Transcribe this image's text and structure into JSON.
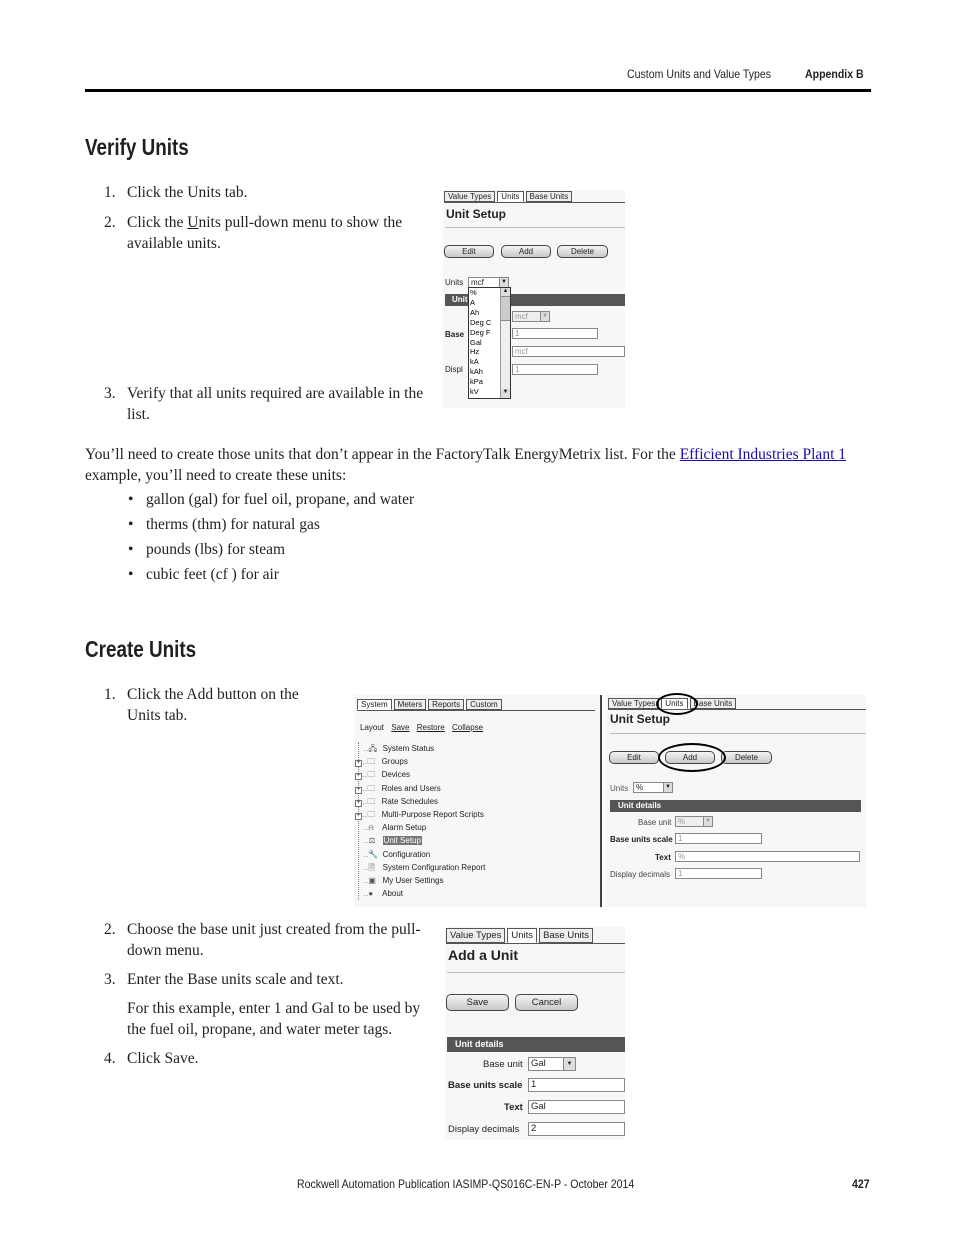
{
  "header": {
    "section": "Custom Units and Value Types",
    "appendix": "Appendix B"
  },
  "verify": {
    "title": "Verify Units",
    "steps": [
      {
        "num": "1.",
        "text": "Click the Units tab."
      },
      {
        "num": "2.",
        "text_pre": "Click the ",
        "text_u": "U",
        "text_post": "nits pull-down menu to show the",
        "text_line2": "available units."
      },
      {
        "num": "3.",
        "text": "Verify that all units required are available in the",
        "text_line2": "list."
      }
    ],
    "screenshot": {
      "tabs": [
        "Value Types",
        "Units",
        "Base Units"
      ],
      "heading": "Unit Setup",
      "buttons": [
        "Edit",
        "Add",
        "Delete"
      ],
      "units_label": "Units",
      "units_value": "mcf",
      "dropdown_options": [
        "%",
        "A",
        "Ah",
        "Deg C",
        "Deg F",
        "Gal",
        "Hz",
        "kA",
        "kAh",
        "kPa",
        "kV"
      ],
      "bar_partial": "Unit",
      "base_partial": "Base",
      "displ_partial": "Displ",
      "base_unit_value": "mcf",
      "scale_value": "1",
      "text_value": "mcf",
      "decimals_value": "1"
    }
  },
  "paragraph": {
    "pre": "You’ll need to create those units that don’t appear in the FactoryTalk EnergyMetrix list. For the ",
    "link": "Efficient Industries Plant 1",
    "post": "example, you’ll need to create these units:"
  },
  "bullets": [
    "gallon (gal) for fuel oil, propane, and water",
    "therms (thm) for natural gas",
    "pounds (lbs) for steam",
    "cubic feet (cf ) for air"
  ],
  "create": {
    "title": "Create Units",
    "steps": [
      {
        "num": "1.",
        "text": "Click the Add button on the",
        "text_line2": "Units tab."
      },
      {
        "num": "2.",
        "text": "Choose the base unit just created from the pull-",
        "text_line2": "down menu."
      },
      {
        "num": "3.",
        "text": "Enter the Base units scale and text."
      },
      {
        "num": "",
        "text": "For this example, enter 1 and Gal to be used by",
        "text_line2": "the fuel oil, propane, and water meter tags."
      },
      {
        "num": "4.",
        "text": "Click Save."
      }
    ],
    "nav_screenshot": {
      "tabs": [
        "System",
        "Meters",
        "Reports",
        "Custom"
      ],
      "layout_label": "Layout",
      "layout_links": [
        "Save",
        "Restore",
        "Collapse"
      ],
      "tree": [
        {
          "label": "System Status",
          "icon": "network-icon",
          "expand": false
        },
        {
          "label": "Groups",
          "icon": "folder-icon",
          "expand": true
        },
        {
          "label": "Devices",
          "icon": "folder-icon",
          "expand": true
        },
        {
          "label": "Roles and Users",
          "icon": "folder-icon",
          "expand": true
        },
        {
          "label": "Rate Schedules",
          "icon": "folder-icon",
          "expand": true
        },
        {
          "label": "Multi-Purpose Report Scripts",
          "icon": "folder-icon",
          "expand": true
        },
        {
          "label": "Alarm Setup",
          "icon": "alarm-icon",
          "expand": false
        },
        {
          "label": "Unit Setup",
          "icon": "scale-icon",
          "expand": false,
          "selected": true
        },
        {
          "label": "Configuration",
          "icon": "wrench-icon",
          "expand": false
        },
        {
          "label": "System Configuration Report",
          "icon": "report-icon",
          "expand": false
        },
        {
          "label": "My User Settings",
          "icon": "user-settings-icon",
          "expand": false
        },
        {
          "label": "About",
          "icon": "info-icon",
          "expand": false
        }
      ]
    },
    "setup_screenshot": {
      "tabs": [
        "Value Types",
        "Units",
        "Base Units"
      ],
      "heading": "Unit Setup",
      "buttons": [
        "Edit",
        "Add",
        "Delete"
      ],
      "units_label": "Units",
      "units_value": "%",
      "bar": "Unit details",
      "base_unit_label": "Base unit",
      "base_unit_value": "%",
      "scale_label": "Base units scale",
      "scale_value": "1",
      "text_label": "Text",
      "text_value": "%",
      "decimals_label": "Display decimals",
      "decimals_value": "1"
    },
    "add_screenshot": {
      "tabs": [
        "Value Types",
        "Units",
        "Base Units"
      ],
      "heading": "Add a Unit",
      "buttons": [
        "Save",
        "Cancel"
      ],
      "bar": "Unit details",
      "base_unit_label": "Base unit",
      "base_unit_value": "Gal",
      "scale_label": "Base units scale",
      "scale_value": "1",
      "text_label": "Text",
      "text_value": "Gal",
      "decimals_label": "Display decimals",
      "decimals_value": "2"
    }
  },
  "footer": {
    "publication": "Rockwell Automation Publication IASIMP-QS016C-EN-P - October 2014",
    "page": "427"
  }
}
